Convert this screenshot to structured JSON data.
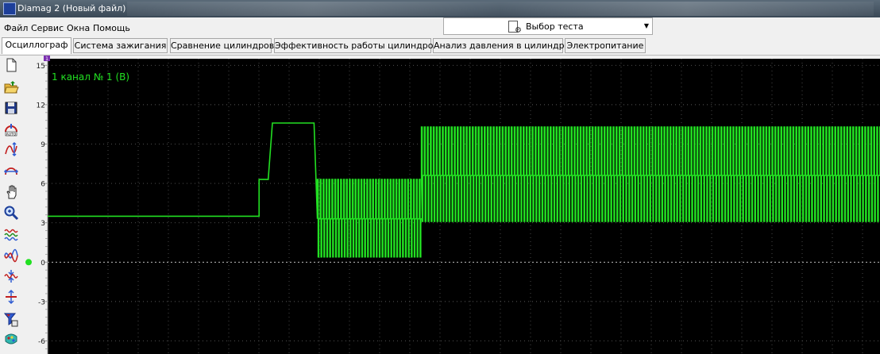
{
  "window": {
    "title": "Diamag 2 (Новый файл)"
  },
  "menu": [
    {
      "label": "Файл",
      "name": "menu-file"
    },
    {
      "label": "Сервис",
      "name": "menu-service"
    },
    {
      "label": "Окна",
      "name": "menu-windows"
    },
    {
      "label": "Помощь",
      "name": "menu-help"
    }
  ],
  "test_select": {
    "label": "Выбор теста"
  },
  "tabs": [
    {
      "label": "Осциллограф",
      "active": true
    },
    {
      "label": "Система зажигания"
    },
    {
      "label": "Сравнение цилиндров"
    },
    {
      "label": "Эффективность работы цилиндров"
    },
    {
      "label": "Анализ давления в цилиндре"
    },
    {
      "label": "Электропитание"
    }
  ],
  "toolbar": [
    {
      "name": "new-file-icon"
    },
    {
      "name": "open-folder-icon"
    },
    {
      "name": "save-icon"
    },
    {
      "name": "auto-scale-icon"
    },
    {
      "name": "vertical-scale-icon"
    },
    {
      "name": "horizontal-scale-icon"
    },
    {
      "name": "hand-pan-icon"
    },
    {
      "name": "zoom-icon"
    },
    {
      "name": "overlay-waves-icon"
    },
    {
      "name": "split-waves-icon"
    },
    {
      "name": "compress-icon"
    },
    {
      "name": "expand-icon"
    },
    {
      "name": "filter-icon"
    },
    {
      "name": "color-palette-icon"
    }
  ],
  "oscilloscope": {
    "channel_label": "1 канал № 1 (В)",
    "marker_label": "1",
    "colors": {
      "trace": "#22e022",
      "background": "#000000",
      "grid": "#5a5a5a",
      "zero_line": "#d8d8d8",
      "axis_text": "#c8c8c8"
    }
  },
  "chart_data": {
    "type": "line",
    "ylim": [
      -7,
      15.5
    ],
    "yticks": [
      15,
      12,
      9,
      6,
      3,
      0,
      -3,
      -6
    ],
    "grid": true,
    "series": [
      {
        "name": "1 канал № 1 (В)",
        "segments": [
          {
            "kind": "flat",
            "x_start": 0,
            "x_end": 0.254,
            "value": 3.5
          },
          {
            "kind": "flat",
            "x_start": 0.254,
            "x_end": 0.265,
            "value": 6.3
          },
          {
            "kind": "flat",
            "x_start": 0.27,
            "x_end": 0.32,
            "value": 10.6
          },
          {
            "kind": "pulse_train",
            "x_start": 0.324,
            "x_end": 0.449,
            "low": 0.4,
            "mid": 3.3,
            "high": 6.3,
            "period": 0.0035
          },
          {
            "kind": "pulse_train",
            "x_start": 0.449,
            "x_end": 1.0,
            "low": 3.1,
            "mid": 6.6,
            "high": 10.3,
            "period": 0.0036
          }
        ]
      }
    ]
  }
}
